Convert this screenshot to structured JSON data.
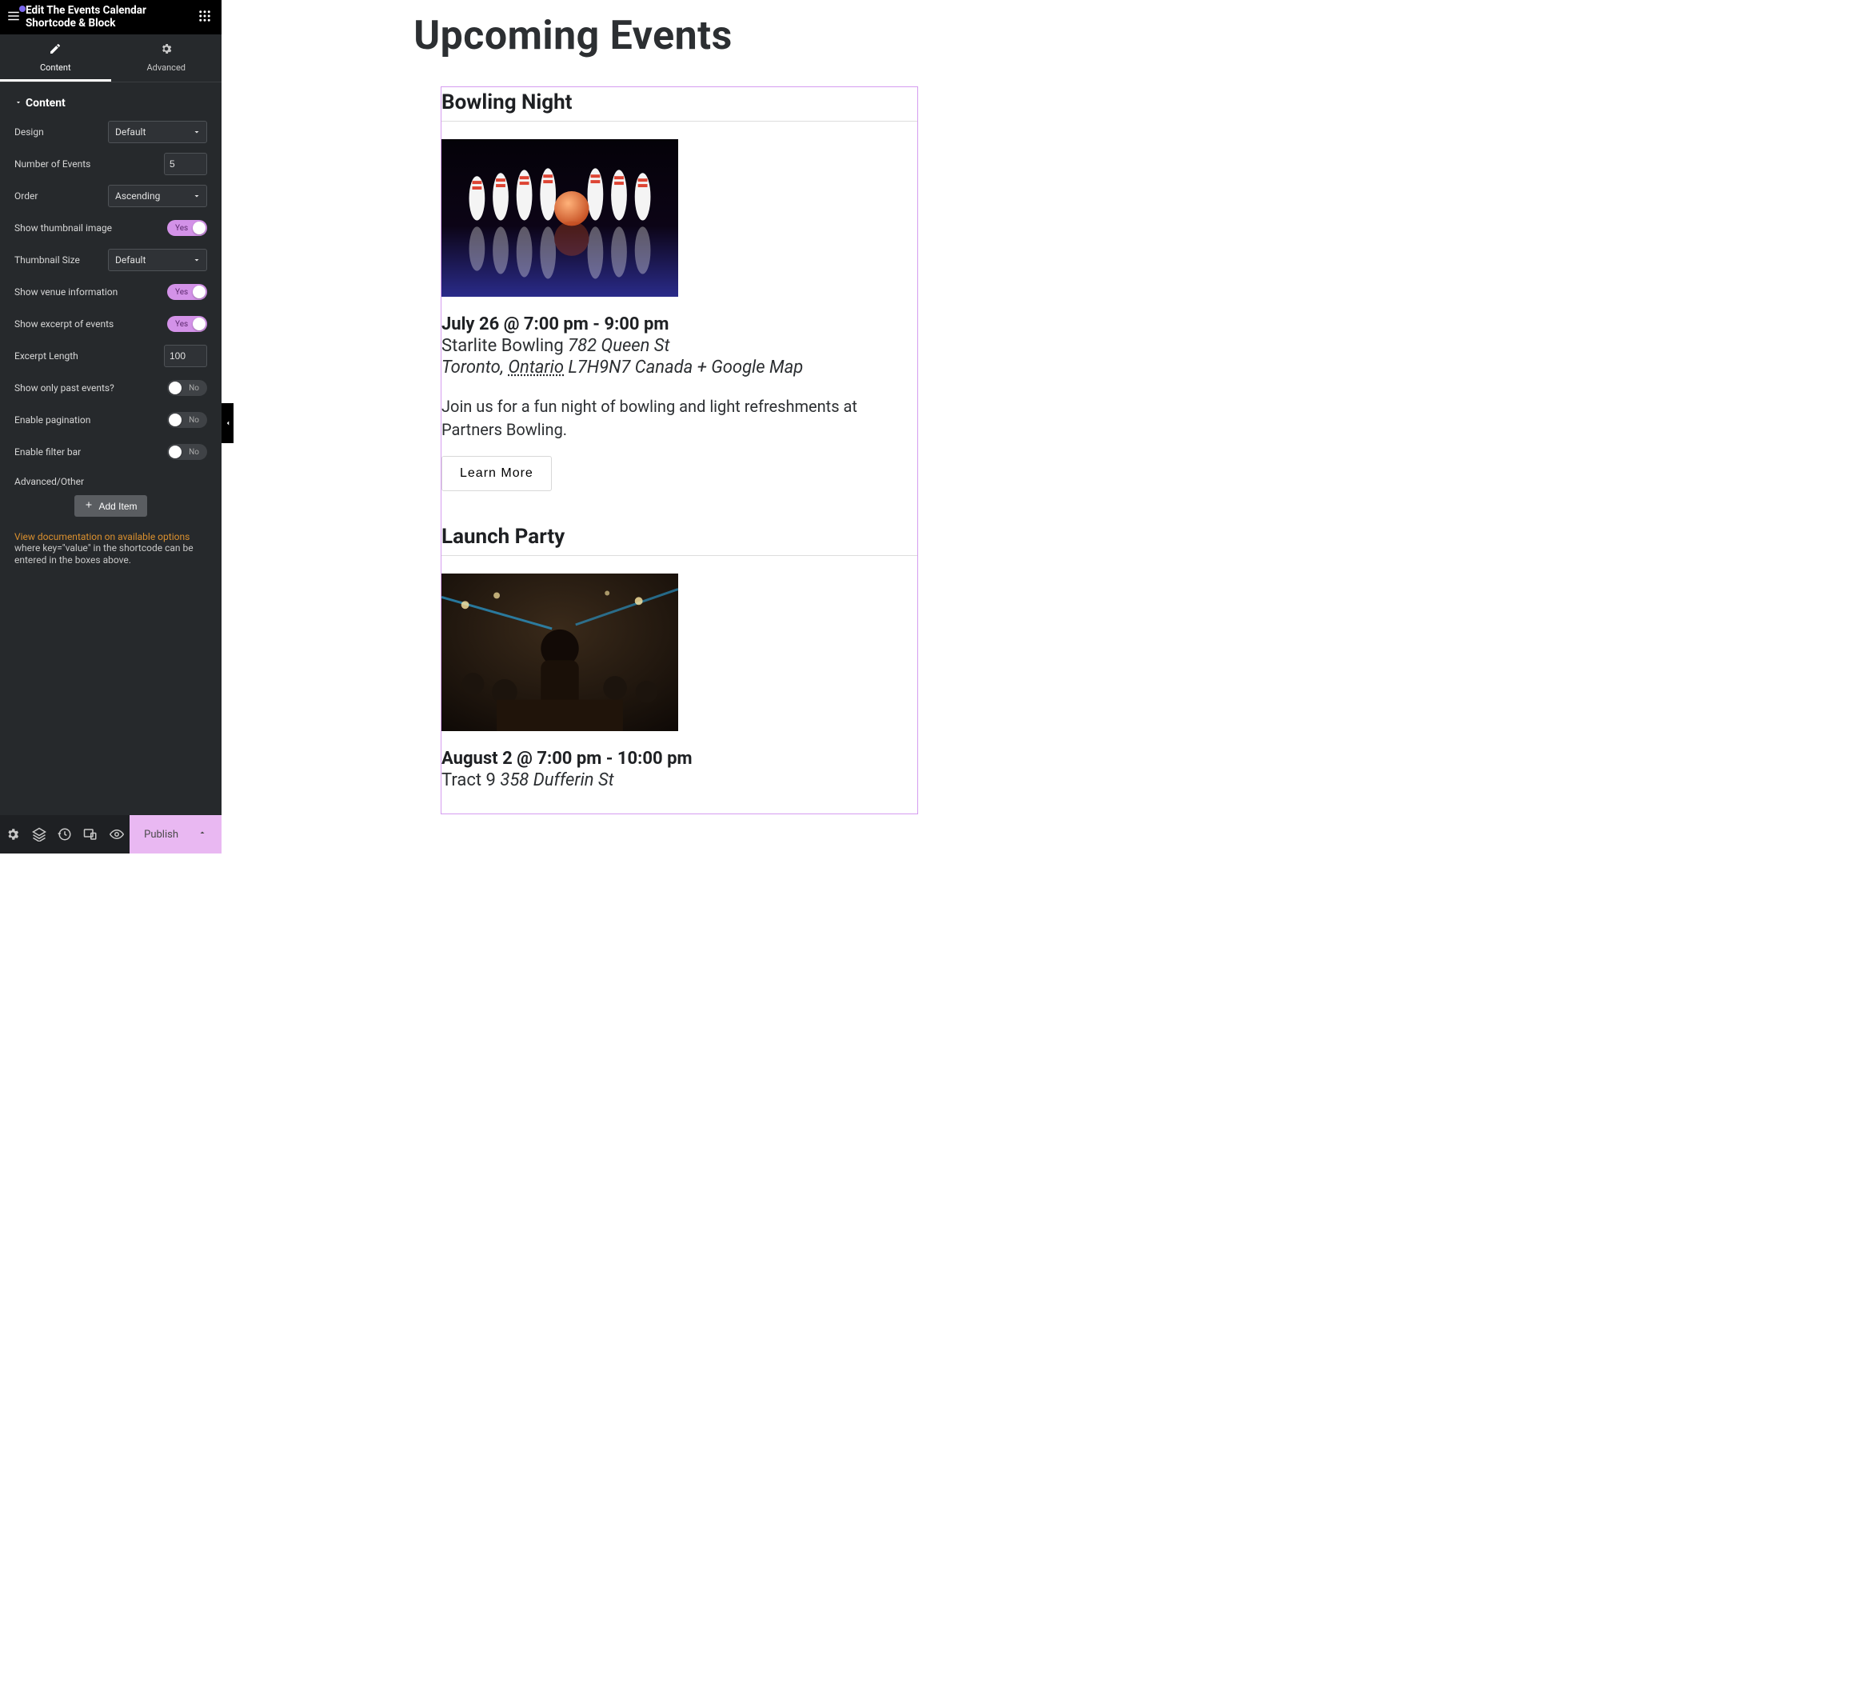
{
  "header": {
    "title": "Edit The Events Calendar Shortcode & Block"
  },
  "tabs": {
    "content": "Content",
    "advanced": "Advanced"
  },
  "section": {
    "title": "Content"
  },
  "controls": {
    "design_label": "Design",
    "design_value": "Default",
    "num_label": "Number of Events",
    "num_value": "5",
    "order_label": "Order",
    "order_value": "Ascending",
    "thumb_label": "Show thumbnail image",
    "thumb_state": "Yes",
    "thumbsize_label": "Thumbnail Size",
    "thumbsize_value": "Default",
    "venue_label": "Show venue information",
    "venue_state": "Yes",
    "excerpt_label": "Show excerpt of events",
    "excerpt_state": "Yes",
    "exlen_label": "Excerpt Length",
    "exlen_value": "100",
    "past_label": "Show only past events?",
    "past_state": "No",
    "pagination_label": "Enable pagination",
    "pagination_state": "No",
    "filter_label": "Enable filter bar",
    "filter_state": "No",
    "advanced_other": "Advanced/Other",
    "add_item": "Add Item",
    "doc_link": "View documentation on available options",
    "doc_help": "where key=\"value\" in the shortcode can be entered in the boxes above."
  },
  "footer": {
    "publish": "Publish"
  },
  "preview": {
    "heading": "Upcoming Events",
    "events": [
      {
        "title": "Bowling Night",
        "date": "July 26 @ 7:00 pm - 9:00 pm",
        "venue_name": "Starlite Bowling",
        "venue_addr": "782 Queen St",
        "city": "Toronto",
        "province": "Ontario",
        "postal": "L7H9N7",
        "country": "Canada",
        "gmap": "+ Google Map",
        "desc": "Join us for a fun night of bowling and light refreshments at Partners Bowling.",
        "learn": "Learn More"
      },
      {
        "title": "Launch Party",
        "date": "August 2 @ 7:00 pm - 10:00 pm",
        "venue_name": "Tract 9",
        "venue_addr": "358 Dufferin St"
      }
    ]
  }
}
